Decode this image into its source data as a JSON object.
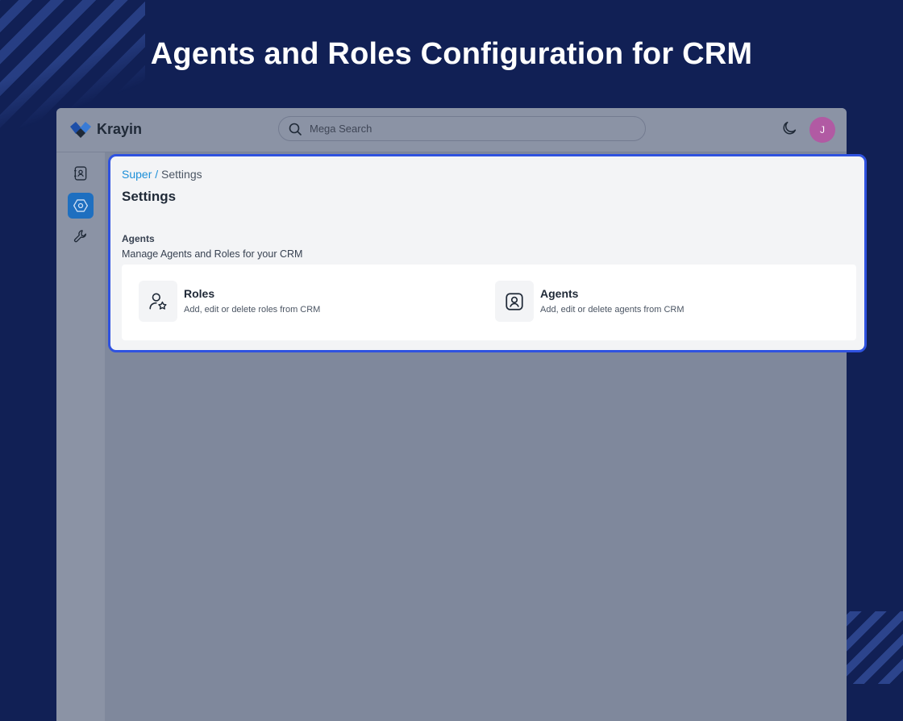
{
  "headline": "Agents and Roles Configuration for CRM",
  "app": {
    "name": "Krayin"
  },
  "search": {
    "placeholder": "Mega Search",
    "value": ""
  },
  "user": {
    "initial": "J",
    "avatar_color": "#b15aa3"
  },
  "sidebar": {
    "items": [
      {
        "name": "contacts",
        "icon": "contact-card-icon",
        "active": false
      },
      {
        "name": "settings",
        "icon": "settings-icon",
        "active": true
      },
      {
        "name": "configuration",
        "icon": "wrench-icon",
        "active": false
      }
    ]
  },
  "breadcrumb": {
    "parent": "Super",
    "separator": "/",
    "current": "Settings"
  },
  "page": {
    "title": "Settings"
  },
  "section": {
    "title": "Agents",
    "description": "Manage Agents and Roles for your CRM",
    "options": [
      {
        "title": "Roles",
        "description": "Add, edit or delete roles from CRM",
        "icon": "user-star-icon"
      },
      {
        "title": "Agents",
        "description": "Add, edit or delete agents from CRM",
        "icon": "user-square-icon"
      }
    ]
  },
  "colors": {
    "background": "#112055",
    "accent": "#1e6fc0",
    "highlight_border": "#2f52e0",
    "link": "#1d8fd8"
  }
}
